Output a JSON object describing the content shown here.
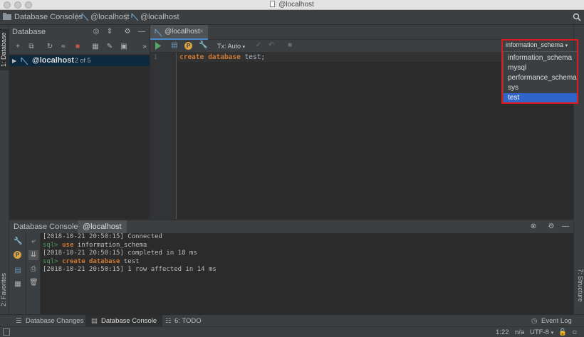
{
  "window": {
    "title": "@localhost"
  },
  "breadcrumbs": [
    "Database Consoles",
    "@localhost",
    "@localhost"
  ],
  "left_stripe": {
    "database_tab": "1: Database",
    "favorites_tab": "2: Favorites"
  },
  "right_stripe": {
    "structure_tab": "7: Structure"
  },
  "database_panel": {
    "title": "Database",
    "tree": [
      {
        "label": "@localhost",
        "count": "2 of 5",
        "expanded": false
      }
    ]
  },
  "editor": {
    "tab_label": "@localhost",
    "tx_mode": "Tx: Auto",
    "lines": [
      {
        "number": "1",
        "keyword1": "create",
        "keyword2": "database",
        "rest": " test;"
      }
    ]
  },
  "schema_selector": {
    "current": "information_schema",
    "options": [
      "information_schema",
      "mysql",
      "performance_schema",
      "sys",
      "test"
    ],
    "selected_index": 4
  },
  "console": {
    "header_label": "Database Console:",
    "session": "@localhost",
    "lines": [
      {
        "type": "log",
        "text": "[2018-10-21 20:50:15] Connected"
      },
      {
        "type": "cmd",
        "prompt": "sql>",
        "keyword": "use",
        "rest": " information_schema"
      },
      {
        "type": "log",
        "text": "[2018-10-21 20:50:15] completed in 18 ms"
      },
      {
        "type": "cmd",
        "prompt": "sql>",
        "keyword": "create database",
        "rest": " test"
      },
      {
        "type": "log",
        "text": "[2018-10-21 20:50:15] 1 row affected in 14 ms"
      }
    ]
  },
  "bottom_tabs": [
    "Database Changes",
    "Database Console",
    "6: TODO"
  ],
  "event_log": "Event Log",
  "status": {
    "position": "1:22",
    "na": "n/a",
    "encoding": "UTF-8"
  },
  "colors": {
    "accent": "#2f65ca",
    "highlight_box": "#e01b1b",
    "keyword": "#cc7832",
    "prompt": "#499c54"
  }
}
